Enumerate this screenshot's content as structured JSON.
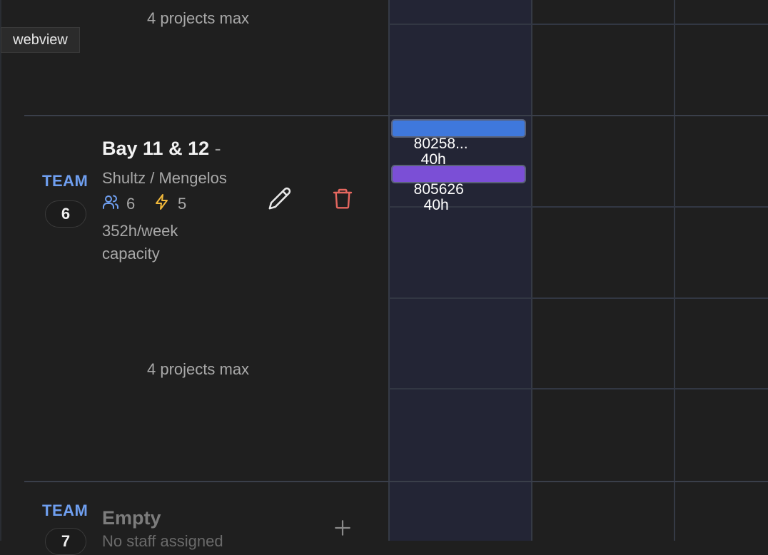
{
  "tooltip": {
    "text": "webview"
  },
  "teams": [
    {
      "max_note": "4 projects max"
    },
    {
      "label": "TEAM",
      "number": "6",
      "title": "Bay 11 & 12",
      "title_suffix": "-",
      "leads": "Shultz / Mengelos",
      "staff_count": "6",
      "power_count": "5",
      "capacity_line1": "352h/week",
      "capacity_line2": "capacity",
      "max_note": "4 projects max",
      "actions": {
        "edit_icon": "pencil-icon",
        "delete_icon": "trash-icon"
      },
      "assignments": [
        {
          "project": "80258...",
          "hours": "40h",
          "color": "#3f78dc"
        },
        {
          "project": "805626",
          "hours": "40h",
          "color": "#7b4fd6"
        }
      ]
    },
    {
      "label": "TEAM",
      "number": "7",
      "title": "Empty",
      "subtitle": "No staff assigned",
      "add_icon": "plus-icon"
    }
  ],
  "colors": {
    "accent_blue": "#6f9ff0",
    "delete_red": "#e5675f",
    "warning_yellow": "#f2b93b",
    "highlight_column": "#232535"
  }
}
